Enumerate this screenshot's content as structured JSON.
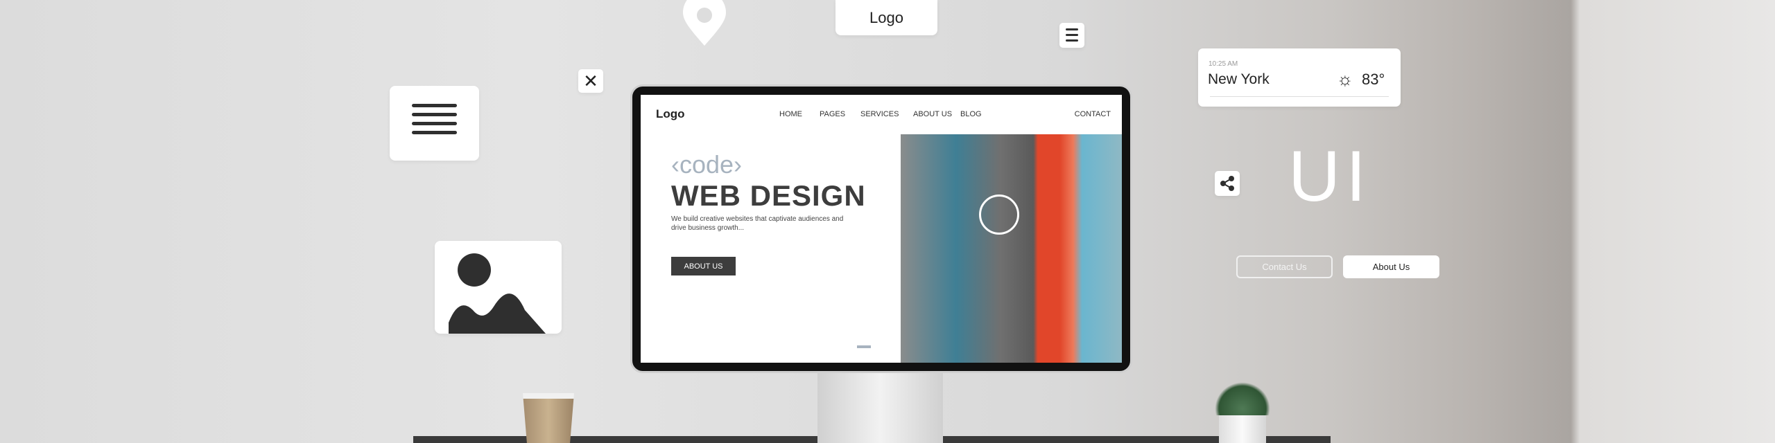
{
  "floating": {
    "logo_card": "Logo",
    "ui_text": "UI",
    "contact_button": "Contact Us",
    "about_button": "About Us"
  },
  "weather": {
    "time": "10:25 AM",
    "city": "New York",
    "temp": "83°",
    "icon": "sun-icon"
  },
  "website": {
    "logo": "Logo",
    "nav": [
      "HOME",
      "PAGES",
      "SERVICES",
      "ABOUT US",
      "BLOG"
    ],
    "contact": "CONTACT",
    "code_tag": "‹code›",
    "headline": "WEB DESIGN",
    "tagline": "We build creative websites that captivate audiences and drive business growth...",
    "cta": "ABOUT US"
  },
  "colors": {
    "accent_orange": "#e1462a",
    "dark": "#3d3d3d",
    "code_gray": "#a7b3bf"
  }
}
